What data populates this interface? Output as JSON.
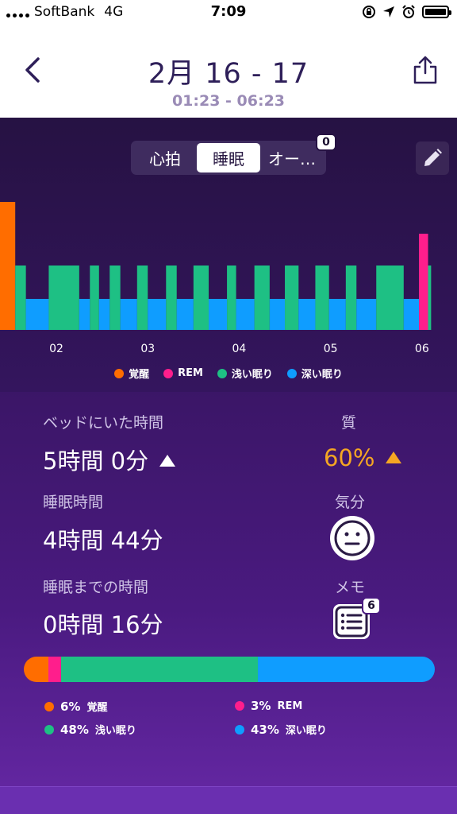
{
  "status_bar": {
    "carrier": "SoftBank",
    "network": "4G",
    "time": "7:09"
  },
  "header": {
    "title": "2月 16 - 17",
    "subtitle": "01:23 - 06:23"
  },
  "tabs": [
    {
      "label": "心拍",
      "active": false
    },
    {
      "label": "睡眠",
      "active": true
    },
    {
      "label": "オー…",
      "active": false
    }
  ],
  "tab_badge": "0",
  "colors": {
    "awake": "#ff6d00",
    "rem": "#ff1e8c",
    "light": "#1ec084",
    "deep": "#0f9dff",
    "accent_orange": "#f5a623"
  },
  "chart_data": {
    "type": "bar",
    "x_ticks": [
      "02",
      "03",
      "04",
      "05",
      "06"
    ],
    "legend": [
      {
        "key": "awake",
        "label": "覚醒"
      },
      {
        "key": "rem",
        "label": "REM"
      },
      {
        "key": "light",
        "label": "浅い眠り"
      },
      {
        "key": "deep",
        "label": "深い眠り"
      }
    ],
    "segments": [
      {
        "stage": "awake",
        "start": "01:23",
        "end": "01:33"
      },
      {
        "stage": "light",
        "start": "01:33",
        "end": "01:40"
      },
      {
        "stage": "deep",
        "start": "01:40",
        "end": "01:55"
      },
      {
        "stage": "light",
        "start": "01:55",
        "end": "02:15"
      },
      {
        "stage": "deep",
        "start": "02:15",
        "end": "02:22"
      },
      {
        "stage": "light",
        "start": "02:22",
        "end": "02:28"
      },
      {
        "stage": "deep",
        "start": "02:28",
        "end": "02:35"
      },
      {
        "stage": "light",
        "start": "02:35",
        "end": "02:42"
      },
      {
        "stage": "deep",
        "start": "02:42",
        "end": "02:53"
      },
      {
        "stage": "light",
        "start": "02:53",
        "end": "03:00"
      },
      {
        "stage": "deep",
        "start": "03:00",
        "end": "03:12"
      },
      {
        "stage": "light",
        "start": "03:12",
        "end": "03:19"
      },
      {
        "stage": "deep",
        "start": "03:19",
        "end": "03:30"
      },
      {
        "stage": "light",
        "start": "03:30",
        "end": "03:40"
      },
      {
        "stage": "deep",
        "start": "03:40",
        "end": "03:52"
      },
      {
        "stage": "light",
        "start": "03:52",
        "end": "03:58"
      },
      {
        "stage": "deep",
        "start": "03:58",
        "end": "04:10"
      },
      {
        "stage": "light",
        "start": "04:10",
        "end": "04:20"
      },
      {
        "stage": "deep",
        "start": "04:20",
        "end": "04:30"
      },
      {
        "stage": "light",
        "start": "04:30",
        "end": "04:39"
      },
      {
        "stage": "deep",
        "start": "04:39",
        "end": "04:50"
      },
      {
        "stage": "light",
        "start": "04:50",
        "end": "04:59"
      },
      {
        "stage": "deep",
        "start": "04:59",
        "end": "05:10"
      },
      {
        "stage": "light",
        "start": "05:10",
        "end": "05:17"
      },
      {
        "stage": "deep",
        "start": "05:17",
        "end": "05:30"
      },
      {
        "stage": "light",
        "start": "05:30",
        "end": "05:48"
      },
      {
        "stage": "deep",
        "start": "05:48",
        "end": "05:58"
      },
      {
        "stage": "rem",
        "start": "05:58",
        "end": "06:04"
      },
      {
        "stage": "light",
        "start": "06:04",
        "end": "06:06"
      }
    ]
  },
  "stats": {
    "time_in_bed_label": "ベッドにいた時間",
    "time_in_bed_value": "5時間 0分",
    "quality_label": "質",
    "quality_value": "60%",
    "sleep_time_label": "睡眠時間",
    "sleep_time_value": "4時間 44分",
    "mood_label": "気分",
    "time_to_sleep_label": "睡眠までの時間",
    "time_to_sleep_value": "0時間 16分",
    "memo_label": "メモ",
    "memo_badge": "6"
  },
  "breakdown": [
    {
      "key": "awake",
      "pct": "6%",
      "label": "覚醒",
      "value": 6
    },
    {
      "key": "rem",
      "pct": "3%",
      "label": "REM",
      "value": 3
    },
    {
      "key": "light",
      "pct": "48%",
      "label": "浅い眠り",
      "value": 48
    },
    {
      "key": "deep",
      "pct": "43%",
      "label": "深い眠り",
      "value": 43
    }
  ]
}
